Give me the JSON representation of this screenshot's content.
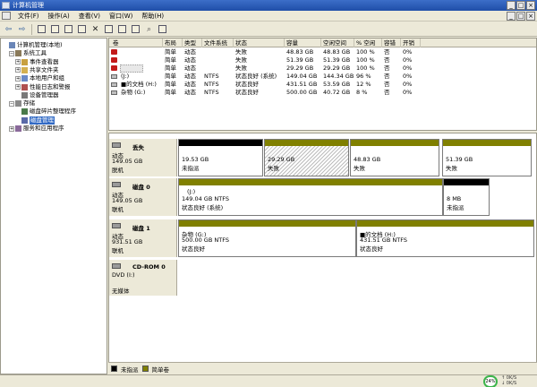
{
  "window": {
    "title": "计算机管理",
    "controls": [
      "_",
      "□",
      "×"
    ]
  },
  "menu": [
    "文件(F)",
    "操作(A)",
    "查看(V)",
    "窗口(W)",
    "帮助(H)"
  ],
  "mdi_controls": [
    "_",
    "□",
    "×"
  ],
  "tree": [
    {
      "label": "计算机管理(本地)",
      "level": 0,
      "exp": "",
      "icon": "computer-icon"
    },
    {
      "label": "系统工具",
      "level": 1,
      "exp": "−",
      "icon": "tools-icon"
    },
    {
      "label": "事件查看器",
      "level": 2,
      "exp": "+",
      "icon": "event-viewer-icon"
    },
    {
      "label": "共享文件夹",
      "level": 2,
      "exp": "+",
      "icon": "shared-folder-icon"
    },
    {
      "label": "本地用户和组",
      "level": 2,
      "exp": "+",
      "icon": "users-icon"
    },
    {
      "label": "性能日志和警报",
      "level": 2,
      "exp": "+",
      "icon": "performance-icon"
    },
    {
      "label": "设备管理器",
      "level": 2,
      "exp": "",
      "icon": "device-manager-icon"
    },
    {
      "label": "存储",
      "level": 1,
      "exp": "−",
      "icon": "storage-icon"
    },
    {
      "label": "磁盘碎片整理程序",
      "level": 2,
      "exp": "",
      "icon": "defrag-icon"
    },
    {
      "label": "磁盘管理",
      "level": 2,
      "exp": "",
      "icon": "disk-management-icon",
      "selected": true
    },
    {
      "label": "服务和应用程序",
      "level": 1,
      "exp": "+",
      "icon": "services-icon"
    }
  ],
  "volume_list": {
    "columns": [
      "卷",
      "布局",
      "类型",
      "文件系统",
      "状态",
      "容量",
      "空闲空间",
      "% 空闲",
      "容错",
      "开销"
    ],
    "rows": [
      {
        "icon": "red",
        "name": "",
        "layout": "简单",
        "type": "动态",
        "fs": "",
        "status": "失败",
        "capacity": "48.83 GB",
        "free": "48.83 GB",
        "pct": "100 %",
        "fault": "否",
        "overhead": "0%"
      },
      {
        "icon": "red",
        "name": "",
        "layout": "简单",
        "type": "动态",
        "fs": "",
        "status": "失败",
        "capacity": "51.39 GB",
        "free": "51.39 GB",
        "pct": "100 %",
        "fault": "否",
        "overhead": "0%"
      },
      {
        "icon": "red",
        "name": "",
        "layout": "简单",
        "type": "动态",
        "fs": "",
        "status": "失败",
        "capacity": "29.29 GB",
        "free": "29.29 GB",
        "pct": "100 %",
        "fault": "否",
        "overhead": "0%"
      },
      {
        "icon": "grey",
        "name": "(J:)",
        "layout": "简单",
        "type": "动态",
        "fs": "NTFS",
        "status": "状态良好 (系统)",
        "capacity": "149.04 GB",
        "free": "144.34 GB",
        "pct": "96 %",
        "fault": "否",
        "overhead": "0%"
      },
      {
        "icon": "grey",
        "name": "■的文档 (H:)",
        "layout": "简单",
        "type": "动态",
        "fs": "NTFS",
        "status": "状态良好",
        "capacity": "431.51 GB",
        "free": "53.59 GB",
        "pct": "12 %",
        "fault": "否",
        "overhead": "0%"
      },
      {
        "icon": "grey",
        "name": "杂物 (G:)",
        "layout": "简单",
        "type": "动态",
        "fs": "NTFS",
        "status": "状态良好",
        "capacity": "500.00 GB",
        "free": "40.72 GB",
        "pct": "8 %",
        "fault": "否",
        "overhead": "0%"
      }
    ]
  },
  "disks": [
    {
      "name": "丢失",
      "lines": [
        "动态",
        "149.05 GB",
        "脱机"
      ],
      "icon": "missing-disk-icon",
      "partitions": [
        {
          "lines": [
            "19.53 GB",
            "未指派"
          ],
          "bar": "#000000"
        },
        {
          "lines": [
            "29.29 GB",
            "失败"
          ],
          "bar": "#808000",
          "hatched": true
        },
        {
          "lines": [
            "48.83 GB",
            "失败"
          ],
          "bar": "#808000"
        },
        {
          "lines": [
            "51.39 GB",
            "失败"
          ],
          "bar": "#808000"
        }
      ]
    },
    {
      "name": "磁盘 0",
      "lines": [
        "动态",
        "149.05 GB",
        "联机"
      ],
      "icon": "disk-icon",
      "partitions": [
        {
          "lines": [
            "(J:)",
            "149.04 GB NTFS",
            "状态良好 (系统)"
          ],
          "bar": "#808000"
        },
        {
          "lines": [
            "8 MB",
            "未指派"
          ],
          "bar": "#000000"
        }
      ]
    },
    {
      "name": "磁盘 1",
      "lines": [
        "动态",
        "931.51 GB",
        "联机"
      ],
      "icon": "disk-icon",
      "partitions": [
        {
          "lines": [
            "杂物  (G:)",
            "500.00 GB NTFS",
            "状态良好"
          ],
          "bar": "#808000"
        },
        {
          "lines": [
            "■的文档 (H:)",
            "431.51 GB NTFS",
            "状态良好"
          ],
          "bar": "#808000"
        }
      ]
    },
    {
      "name": "CD-ROM 0",
      "lines": [
        "DVD (I:)",
        "",
        "无媒体"
      ],
      "icon": "cdrom-icon",
      "partitions": []
    }
  ],
  "legend": [
    {
      "label": "未指派",
      "color": "#000000"
    },
    {
      "label": "简单卷",
      "color": "#808000"
    }
  ],
  "tray": {
    "gauge": "24%",
    "net_up": "0K/S",
    "net_down": "0K/S"
  }
}
